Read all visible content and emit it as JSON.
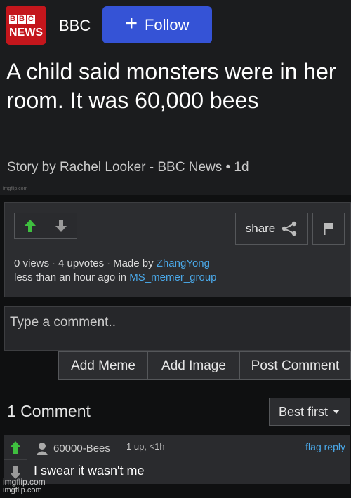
{
  "article": {
    "logo_text_top": "BBC",
    "logo_text_bottom": "NEWS",
    "source": "BBC",
    "follow_label": "Follow",
    "headline": "A child said monsters were in her room. It was 60,000 bees",
    "byline": "Story by Rachel Looker - BBC News • 1d",
    "watermark": "imgflip.com"
  },
  "post": {
    "share_label": "share",
    "views": "0 views",
    "upvotes": "4 upvotes",
    "made_by_label": "Made by",
    "author": "ZhangYong",
    "time_text": "less than an hour ago in",
    "stream": "MS_memer_group"
  },
  "comment_form": {
    "placeholder": "Type a comment..",
    "buttons": [
      "Add Meme",
      "Add Image",
      "Post Comment"
    ]
  },
  "comments": {
    "count_label": "1 Comment",
    "sort_label": "Best first",
    "items": [
      {
        "user": "60000-Bees",
        "meta": "1 up, <1h",
        "flag": "flag",
        "reply": "reply",
        "text": "I swear it wasn't me"
      }
    ]
  },
  "footer": {
    "watermark": "imgflip.com",
    "watermark2": "imgflip.com"
  },
  "colors": {
    "accent": "#3553d6",
    "link": "#4aa8e8",
    "upvote": "#3fbf3f",
    "brand": "#c4161c"
  },
  "icons": [
    "plus-icon",
    "upvote-arrow-icon",
    "downvote-arrow-icon",
    "share-icon",
    "flag-icon",
    "user-icon",
    "caret-down-icon"
  ]
}
